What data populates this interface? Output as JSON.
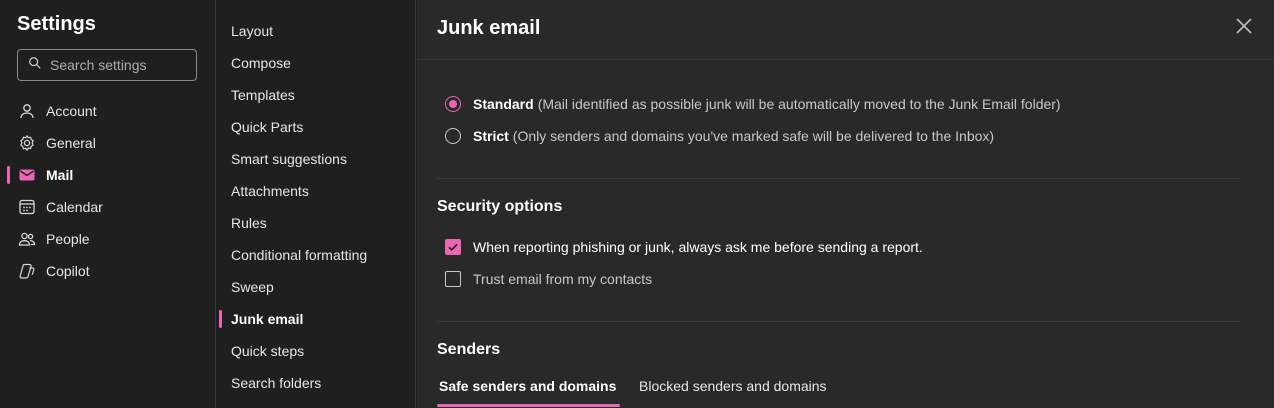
{
  "sidebar": {
    "title": "Settings",
    "search_placeholder": "Search settings",
    "items": [
      {
        "label": "Account",
        "icon": "person-icon"
      },
      {
        "label": "General",
        "icon": "gear-icon"
      },
      {
        "label": "Mail",
        "icon": "mail-icon",
        "active": true
      },
      {
        "label": "Calendar",
        "icon": "calendar-icon"
      },
      {
        "label": "People",
        "icon": "people-icon"
      },
      {
        "label": "Copilot",
        "icon": "copilot-icon"
      }
    ]
  },
  "submenu": {
    "items": [
      {
        "label": "Layout"
      },
      {
        "label": "Compose"
      },
      {
        "label": "Templates"
      },
      {
        "label": "Quick Parts"
      },
      {
        "label": "Smart suggestions"
      },
      {
        "label": "Attachments"
      },
      {
        "label": "Rules"
      },
      {
        "label": "Conditional formatting"
      },
      {
        "label": "Sweep"
      },
      {
        "label": "Junk email",
        "active": true
      },
      {
        "label": "Quick steps"
      },
      {
        "label": "Search folders"
      }
    ]
  },
  "main": {
    "title": "Junk email",
    "filter_options": [
      {
        "label": "Standard",
        "description": "(Mail identified as possible junk will be automatically moved to the Junk Email folder)",
        "selected": true
      },
      {
        "label": "Strict",
        "description": "(Only senders and domains you've marked safe will be delivered to the Inbox)",
        "selected": false
      }
    ],
    "security": {
      "title": "Security options",
      "options": [
        {
          "label": "When reporting phishing or junk, always ask me before sending a report.",
          "checked": true
        },
        {
          "label": "Trust email from my contacts",
          "checked": false
        }
      ]
    },
    "senders": {
      "title": "Senders",
      "tabs": [
        {
          "label": "Safe senders and domains",
          "active": true
        },
        {
          "label": "Blocked senders and domains",
          "active": false
        }
      ]
    }
  },
  "colors": {
    "accent": "#e868b3",
    "background": "#1f1f1f",
    "panel": "#292929"
  }
}
